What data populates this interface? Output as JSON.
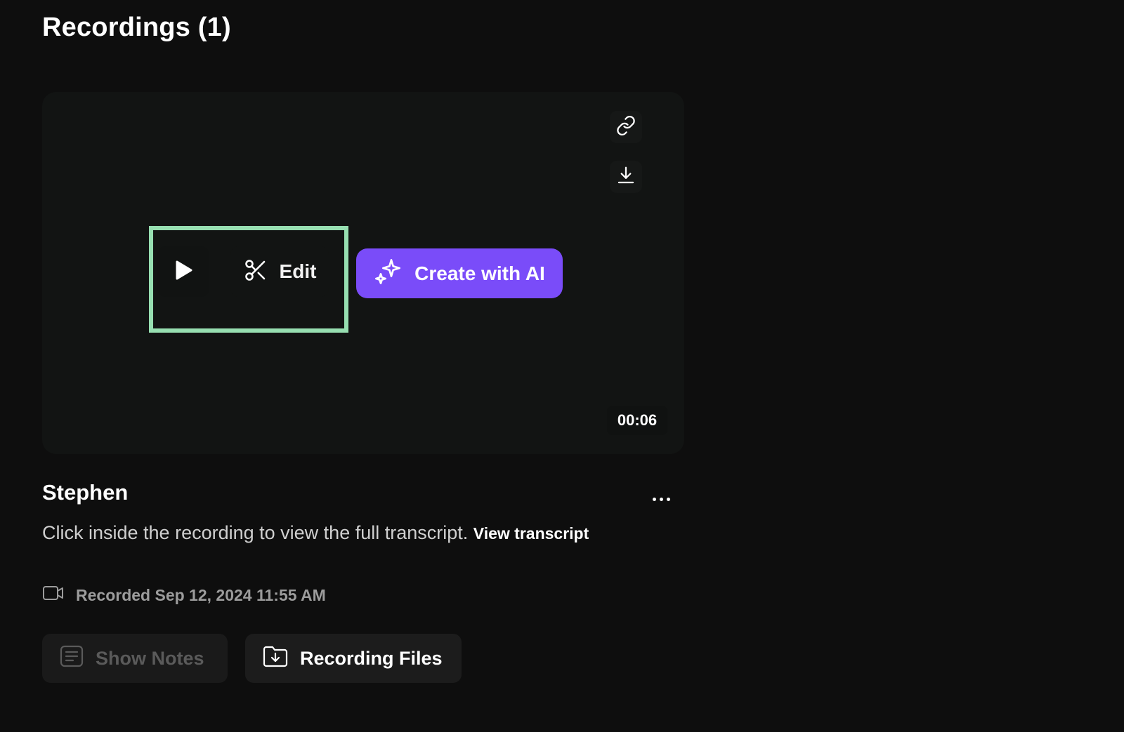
{
  "header": {
    "title": "Recordings (1)"
  },
  "player": {
    "edit_label": "Edit",
    "ai_label": "Create with AI",
    "duration": "00:06",
    "highlight_color": "#97dfb1",
    "ai_color": "#7a4cf9"
  },
  "recording": {
    "name": "Stephen",
    "description": "Click inside the recording to view the full transcript.",
    "view_transcript_label": "View transcript",
    "recorded_text": "Recorded Sep 12, 2024 11:55 AM"
  },
  "actions": {
    "show_notes_label": "Show Notes",
    "show_notes_disabled": true,
    "recording_files_label": "Recording Files"
  },
  "icons": {
    "link": "link-icon",
    "download": "download-icon",
    "play": "play-icon",
    "edit": "scissors-icon",
    "ai": "sparkle-icon",
    "more": "more-horizontal-icon",
    "video": "video-camera-icon",
    "notes": "notes-icon",
    "files": "folder-download-icon"
  }
}
